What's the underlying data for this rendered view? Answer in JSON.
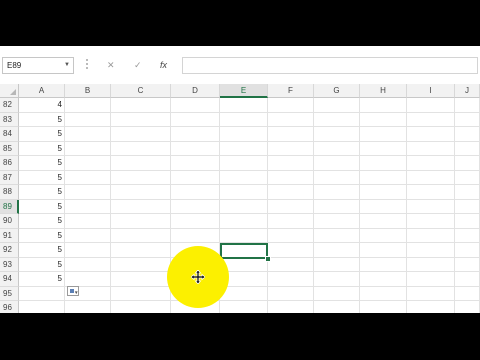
{
  "formula_bar": {
    "name_box": "E89",
    "cancel_icon": "✕",
    "enter_icon": "✓",
    "fx_label": "fx",
    "formula_value": ""
  },
  "columns": [
    "A",
    "B",
    "C",
    "D",
    "E",
    "F",
    "G",
    "H",
    "I",
    "J"
  ],
  "active_column": "E",
  "rows": [
    {
      "num": "82",
      "a": "4"
    },
    {
      "num": "83",
      "a": "5"
    },
    {
      "num": "84",
      "a": "5"
    },
    {
      "num": "85",
      "a": "5"
    },
    {
      "num": "86",
      "a": "5"
    },
    {
      "num": "87",
      "a": "5"
    },
    {
      "num": "88",
      "a": "5"
    },
    {
      "num": "89",
      "a": "5"
    },
    {
      "num": "90",
      "a": "5"
    },
    {
      "num": "91",
      "a": "5"
    },
    {
      "num": "92",
      "a": "5"
    },
    {
      "num": "93",
      "a": "5"
    },
    {
      "num": "94",
      "a": "5"
    },
    {
      "num": "95",
      "a": ""
    },
    {
      "num": "96",
      "a": ""
    }
  ],
  "active_row": "89",
  "selected_cell": "E89",
  "colors": {
    "selection": "#217346",
    "cursor_highlight": "#fcf000"
  }
}
